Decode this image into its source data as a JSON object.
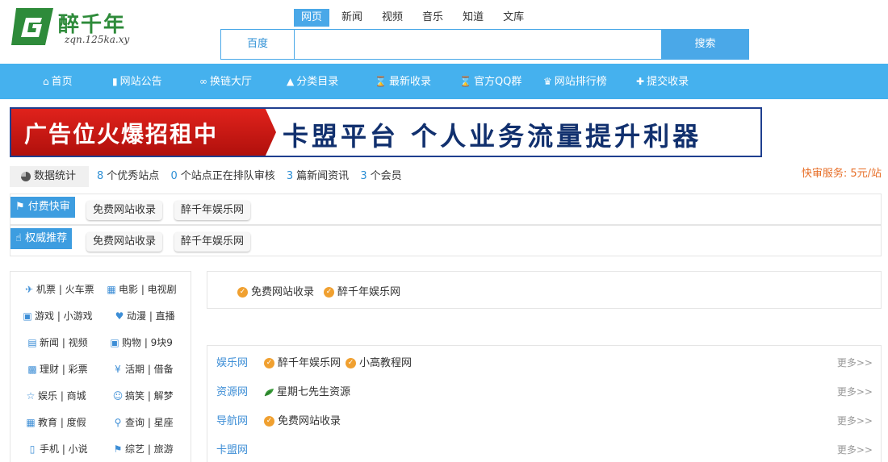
{
  "logo": {
    "name": "醉千年",
    "domain": "zqn.125ka.xy"
  },
  "search": {
    "tabs": [
      "网页",
      "新闻",
      "视频",
      "音乐",
      "知道",
      "文库"
    ],
    "active_tab": "网页",
    "engine": "百度",
    "input_value": "",
    "button_label": "搜索"
  },
  "nav": {
    "items": [
      {
        "label": "首页",
        "icon": "home-icon"
      },
      {
        "label": "网站公告",
        "icon": "document-icon"
      },
      {
        "label": "换链大厅",
        "icon": "link-icon"
      },
      {
        "label": "分类目录",
        "icon": "sitemap-icon"
      },
      {
        "label": "最新收录",
        "icon": "hourglass-icon"
      },
      {
        "label": "官方QQ群",
        "icon": "hourglass-icon"
      },
      {
        "label": "网站排行榜",
        "icon": "trophy-icon"
      },
      {
        "label": "提交收录",
        "icon": "plus-icon"
      }
    ]
  },
  "banner": {
    "left_text": "广告位火爆招租中",
    "right_text": "卡盟平台 个人业务流量提升利器"
  },
  "stats": {
    "label": "数据统计",
    "items": [
      {
        "num": "8",
        "label": "个优秀站点"
      },
      {
        "num": "0",
        "label": "个站点正在排队审核"
      },
      {
        "num": "3",
        "label": "篇新闻资讯"
      },
      {
        "num": "3",
        "label": "个会员"
      }
    ],
    "right": "快审服务: 5元/站"
  },
  "fast_rows": [
    {
      "tag": "付费快审",
      "chips": [
        "免费网站收录",
        "醉千年娱乐网"
      ]
    },
    {
      "tag": "权威推荐",
      "chips": [
        "免费网站收录",
        "醉千年娱乐网"
      ]
    }
  ],
  "categories": [
    {
      "icon": "plane-icon",
      "label": "机票 | 火车票"
    },
    {
      "icon": "film-icon",
      "label": "电影 | 电视剧"
    },
    {
      "icon": "gamepad-icon",
      "label": "游戏 | 小游戏"
    },
    {
      "icon": "heart-icon",
      "label": "动漫 | 直播"
    },
    {
      "icon": "newspaper-icon",
      "label": "新闻 | 视频"
    },
    {
      "icon": "cart-icon",
      "label": "购物 | 9块9"
    },
    {
      "icon": "money-icon",
      "label": "理财 | 彩票"
    },
    {
      "icon": "yen-icon",
      "label": "活期 | 借备"
    },
    {
      "icon": "star-icon",
      "label": "娱乐 | 商城"
    },
    {
      "icon": "smile-icon",
      "label": "搞笑 | 解梦"
    },
    {
      "icon": "map-icon",
      "label": "教育 | 度假"
    },
    {
      "icon": "search-icon",
      "label": "查询 | 星座"
    },
    {
      "icon": "phone-icon",
      "label": "手机 | 小说"
    },
    {
      "icon": "bookmark-icon",
      "label": "综艺 | 旅游"
    }
  ],
  "featured": [
    "免费网站收录",
    "醉千年娱乐网"
  ],
  "list_rows": [
    {
      "cat": "娱乐网",
      "items": [
        "醉千年娱乐网",
        "小高教程网"
      ],
      "icon": "badge",
      "more": "更多>>"
    },
    {
      "cat": "资源网",
      "items": [
        "星期七先生资源"
      ],
      "icon": "leaf",
      "more": "更多>>"
    },
    {
      "cat": "导航网",
      "items": [
        "免费网站收录"
      ],
      "icon": "badge",
      "more": "更多>>"
    },
    {
      "cat": "卡盟网",
      "items": [],
      "icon": "badge",
      "more": "更多>>"
    }
  ]
}
